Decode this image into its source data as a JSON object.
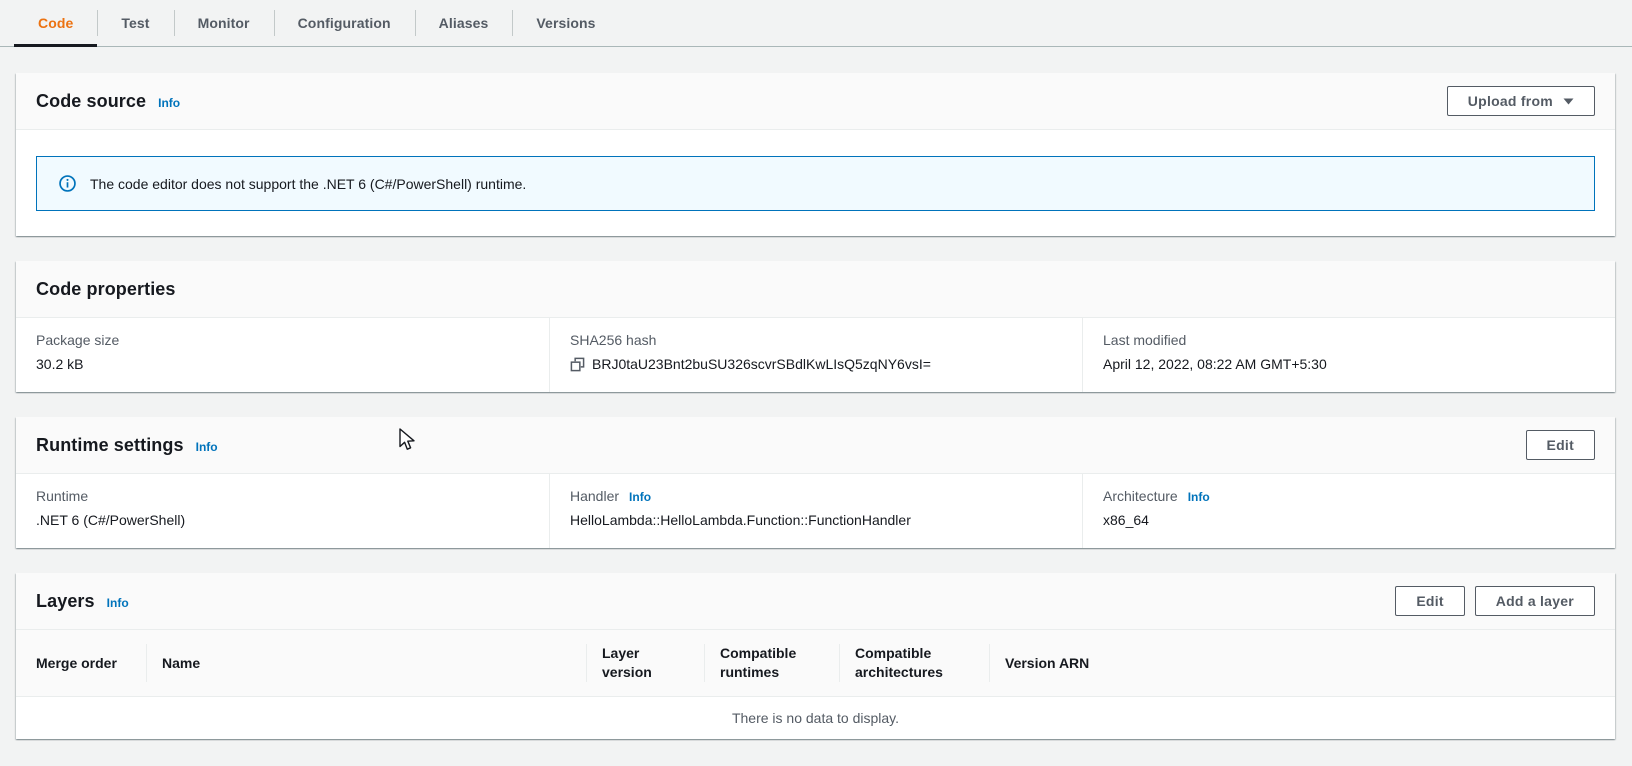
{
  "tabs": [
    {
      "label": "Code",
      "active": true
    },
    {
      "label": "Test"
    },
    {
      "label": "Monitor"
    },
    {
      "label": "Configuration"
    },
    {
      "label": "Aliases"
    },
    {
      "label": "Versions"
    }
  ],
  "code_source": {
    "title": "Code source",
    "info_label": "Info",
    "upload_button_label": "Upload from",
    "alert_text": "The code editor does not support the .NET 6 (C#/PowerShell) runtime."
  },
  "code_properties": {
    "title": "Code properties",
    "package_size": {
      "label": "Package size",
      "value": "30.2 kB"
    },
    "sha256": {
      "label": "SHA256 hash",
      "value": "BRJ0taU23Bnt2buSU326scvrSBdlKwLIsQ5zqNY6vsI="
    },
    "last_modified": {
      "label": "Last modified",
      "value": "April 12, 2022, 08:22 AM GMT+5:30"
    }
  },
  "runtime_settings": {
    "title": "Runtime settings",
    "info_label": "Info",
    "edit_button_label": "Edit",
    "runtime": {
      "label": "Runtime",
      "value": ".NET 6 (C#/PowerShell)"
    },
    "handler": {
      "label": "Handler",
      "info_label": "Info",
      "value": "HelloLambda::HelloLambda.Function::FunctionHandler"
    },
    "architecture": {
      "label": "Architecture",
      "info_label": "Info",
      "value": "x86_64"
    }
  },
  "layers": {
    "title": "Layers",
    "info_label": "Info",
    "edit_button_label": "Edit",
    "add_layer_button_label": "Add a layer",
    "columns": [
      "Merge order",
      "Name",
      "Layer version",
      "Compatible runtimes",
      "Compatible architectures",
      "Version ARN"
    ],
    "empty_text": "There is no data to display."
  },
  "colors": {
    "active_tab_orange": "#ec7211",
    "link_blue": "#0073bb",
    "alert_bg": "#f1faff",
    "alert_border": "#0073bb",
    "page_bg": "#f2f3f3",
    "text_dark": "#16191f",
    "text_gray": "#545b64"
  }
}
